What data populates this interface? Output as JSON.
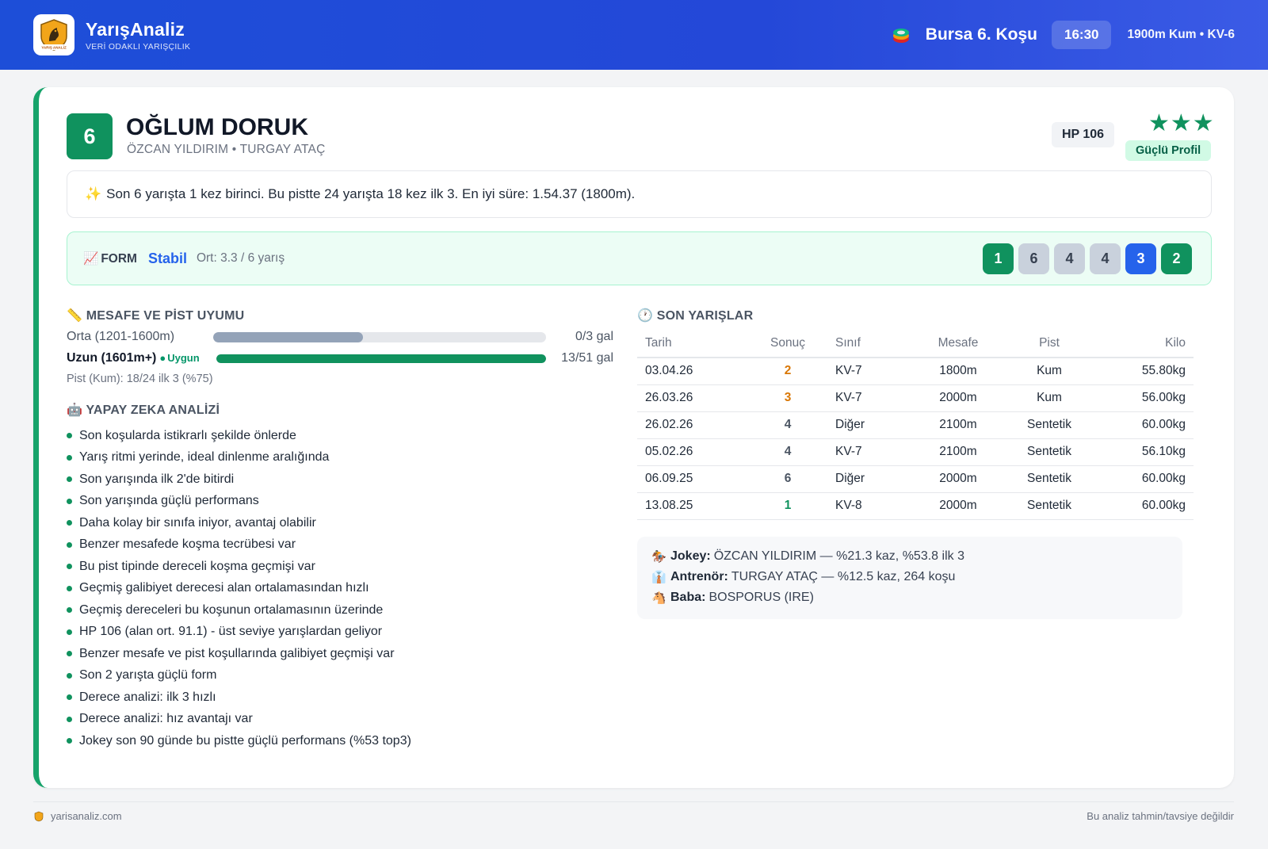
{
  "header": {
    "brand_title": "YarışAnaliz",
    "brand_subtitle": "VERİ ODAKLI YARIŞÇILIK",
    "logo_text": "YARIŞ ANALİZ",
    "race_name": "Bursa 6. Koşu",
    "race_time": "16:30",
    "race_meta": "1900m Kum • KV-6"
  },
  "horse": {
    "number": "6",
    "name": "OĞLUM DORUK",
    "subtitle": "ÖZCAN YILDIRIM • TURGAY ATAÇ",
    "hp": "HP 106",
    "stars": "★★★",
    "profile": "Güçlü Profil"
  },
  "summary": {
    "icon": "sparkles-icon",
    "text": "Son 6 yarışta 1 kez birinci. Bu pistte 24 yarışta 18 kez ilk 3. En iyi süre: 1.54.37 (1800m)."
  },
  "form": {
    "label": "FORM",
    "state": "Stabil",
    "avg": "Ort: 3.3 / 6 yarış",
    "results": [
      {
        "value": "1",
        "kind": "win"
      },
      {
        "value": "6",
        "kind": "mid"
      },
      {
        "value": "4",
        "kind": "mid"
      },
      {
        "value": "4",
        "kind": "mid"
      },
      {
        "value": "3",
        "kind": "blue"
      },
      {
        "value": "2",
        "kind": "win"
      }
    ]
  },
  "distance": {
    "title": "MESAFE VE PİST UYUMU",
    "rows": [
      {
        "label": "Orta (1201-1600m)",
        "fill_fraction": 0.45,
        "value": "0/3 gal"
      },
      {
        "label": "Uzun (1601m+)",
        "badge": "Uygun",
        "fill_fraction": 1.0,
        "value": "13/51 gal"
      }
    ],
    "track_note": "Pist (Kum): 18/24 ilk 3 (%75)"
  },
  "ai": {
    "title": "YAPAY ZEKA ANALİZİ",
    "items": [
      "Son koşularda istikrarlı şekilde önlerde",
      "Yarış ritmi yerinde, ideal dinlenme aralığında",
      "Son yarışında ilk 2'de bitirdi",
      "Son yarışında güçlü performans",
      "Daha kolay bir sınıfa iniyor, avantaj olabilir",
      "Benzer mesafede koşma tecrübesi var",
      "Bu pist tipinde dereceli koşma geçmişi var",
      "Geçmiş galibiyet derecesi alan ortalamasından hızlı",
      "Geçmiş dereceleri bu koşunun ortalamasının üzerinde",
      "HP 106 (alan ort. 91.1) - üst seviye yarışlardan geliyor",
      "Benzer mesafe ve pist koşullarında galibiyet geçmişi var",
      "Son 2 yarışta güçlü form",
      "Derece analizi: ilk 3 hızlı",
      "Derece analizi: hız avantajı var",
      "Jokey son 90 günde bu pistte güçlü performans (%53 top3)"
    ]
  },
  "races": {
    "title": "SON YARIŞLAR",
    "columns": [
      "Tarih",
      "Sonuç",
      "Sınıf",
      "Mesafe",
      "Pist",
      "Kilo"
    ],
    "rows": [
      [
        "03.04.26",
        "2",
        "KV-7",
        "1800m",
        "Kum",
        "55.80kg"
      ],
      [
        "26.03.26",
        "3",
        "KV-7",
        "2000m",
        "Kum",
        "56.00kg"
      ],
      [
        "26.02.26",
        "4",
        "Diğer",
        "2100m",
        "Sentetik",
        "60.00kg"
      ],
      [
        "05.02.26",
        "4",
        "KV-7",
        "2100m",
        "Sentetik",
        "56.10kg"
      ],
      [
        "06.09.25",
        "6",
        "Diğer",
        "2000m",
        "Sentetik",
        "60.00kg"
      ],
      [
        "13.08.25",
        "1",
        "KV-8",
        "2000m",
        "Sentetik",
        "60.00kg"
      ]
    ]
  },
  "people": {
    "jockey_label": "Jokey:",
    "jockey_value": "ÖZCAN YILDIRIM — %21.3 kaz, %53.8 ilk 3",
    "trainer_label": "Antrenör:",
    "trainer_value": "TURGAY ATAÇ — %12.5 kaz, 264 koşu",
    "sire_label": "Baba:",
    "sire_value": "BOSPORUS (IRE)"
  },
  "footer": {
    "site": "yarisanaliz.com",
    "disclaimer": "Bu analiz tahmin/tavsiye değildir"
  },
  "colors": {
    "header_blue": "#1d4ed8",
    "accent_green": "#10925e",
    "form_blue": "#2563eb",
    "place_orange": "#d97706"
  }
}
